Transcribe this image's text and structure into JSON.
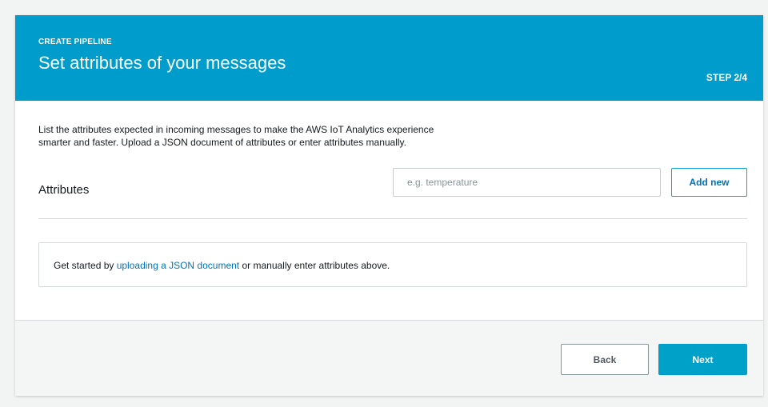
{
  "header": {
    "eyebrow": "CREATE PIPELINE",
    "title": "Set attributes of your messages",
    "step": "STEP 2/4"
  },
  "intro": {
    "line1": "List the attributes expected in incoming messages to make the AWS IoT Analytics experience",
    "line2": "smarter and faster. Upload a JSON document of attributes or enter attributes manually."
  },
  "attributes": {
    "label": "Attributes",
    "input_value": "",
    "input_placeholder": "e.g. temperature",
    "add_button_label": "Add new"
  },
  "empty_state": {
    "text_before": "Get started by ",
    "link_text": "uploading a JSON document",
    "text_after": " or manually enter attributes above."
  },
  "footer": {
    "back_label": "Back",
    "next_label": "Next"
  },
  "colors": {
    "accent": "#009ccb",
    "link": "#0073bb",
    "page_background": "#f2f3f3"
  }
}
